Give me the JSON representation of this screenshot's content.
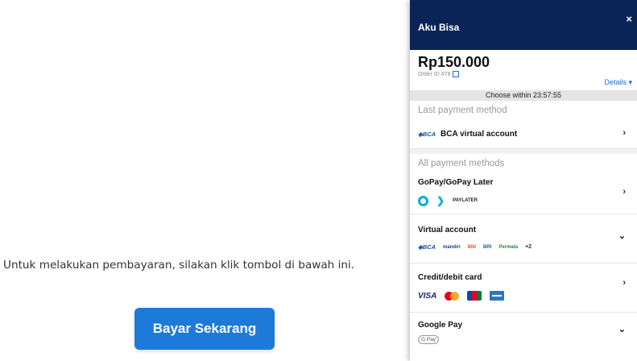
{
  "page": {
    "instruction": "Untuk melakukan pembayaran, silakan klik tombol di bawah ini.",
    "pay_button": "Bayar Sekarang"
  },
  "panel": {
    "merchant": "Aku Bisa",
    "close": "×",
    "amount": "Rp150.000",
    "order_id": "Order ID #78",
    "details": "Details ▾",
    "timer": "Choose within 23:57:55",
    "last_method_title": "Last payment method",
    "last_method": {
      "bank_logo": "BCA",
      "label": "BCA virtual account",
      "chevron": "›"
    },
    "all_methods_title": "All payment methods",
    "methods": [
      {
        "label": "GoPay/GoPay Later",
        "chevron": "›",
        "logos": [
          "gopay-icon",
          "gopay-arrow-icon",
          "gopay-later-logo"
        ],
        "gopay_later_text": "PAYLATER"
      },
      {
        "label": "Virtual account",
        "chevron": "⌄",
        "logos": [
          "BCA",
          "mandiri",
          "BNI",
          "BRI",
          "Permata"
        ],
        "more": "+2"
      },
      {
        "label": "Credit/debit card",
        "chevron": "›",
        "visa": "VISA"
      },
      {
        "label": "Google Pay",
        "chevron": "⌄",
        "gpay": "G Pay"
      }
    ]
  },
  "colors": {
    "panel_header": "#0b2457",
    "pay_button": "#1e7ad8",
    "link": "#1e6bd6",
    "timer_bg": "#e4e4e4"
  }
}
